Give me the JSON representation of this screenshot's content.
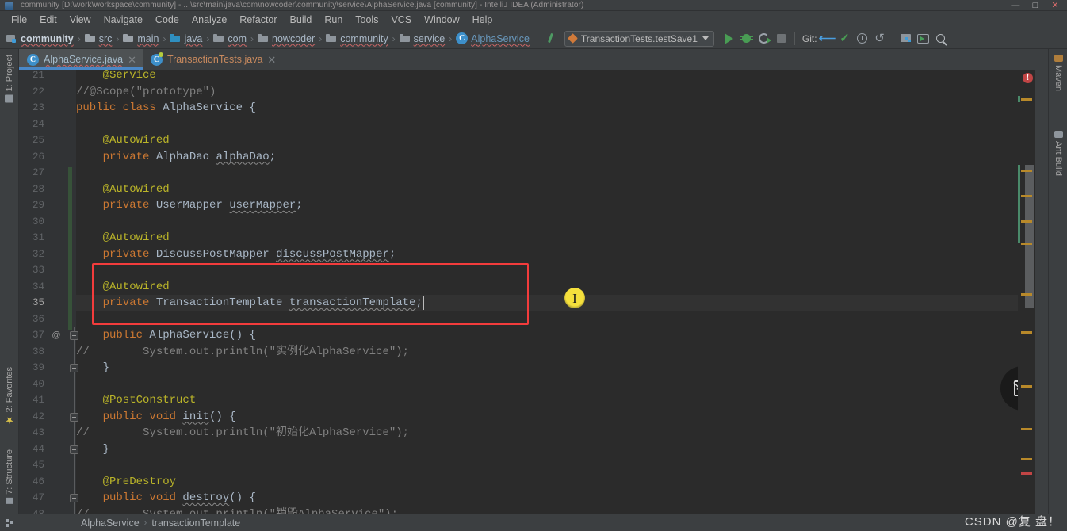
{
  "window": {
    "title": "community [D:\\work\\workspace\\community] - ...\\src\\main\\java\\com\\nowcoder\\community\\service\\AlphaService.java [community] - IntelliJ IDEA (Administrator)",
    "minimize": "—",
    "maximize": "□",
    "close": "✕"
  },
  "menubar": {
    "items": [
      "File",
      "Edit",
      "View",
      "Navigate",
      "Code",
      "Analyze",
      "Refactor",
      "Build",
      "Run",
      "Tools",
      "VCS",
      "Window",
      "Help"
    ]
  },
  "breadcrumb": {
    "items": [
      {
        "label": "community",
        "icon": "module-icon"
      },
      {
        "label": "src",
        "icon": "folder-icon"
      },
      {
        "label": "main",
        "icon": "folder-icon"
      },
      {
        "label": "java",
        "icon": "source-folder-icon"
      },
      {
        "label": "com",
        "icon": "package-icon"
      },
      {
        "label": "nowcoder",
        "icon": "package-icon"
      },
      {
        "label": "community",
        "icon": "package-icon"
      },
      {
        "label": "service",
        "icon": "package-icon"
      },
      {
        "label": "AlphaService",
        "icon": "class-icon"
      }
    ],
    "separator": "›"
  },
  "toolbar": {
    "make_project_label": "make-project",
    "run_config": "TransactionTests.testSave1",
    "run_label": "Run",
    "debug_label": "Debug",
    "coverage_label": "Run with Coverage",
    "stop_label": "Stop",
    "git_label": "Git:",
    "update_project_label": "Update Project",
    "commit_label": "Commit",
    "history_label": "History",
    "rollback_label": "Rollback",
    "structure_label": "Structure",
    "terminal_label": "Terminal",
    "search_label": "Search Everywhere"
  },
  "left_tools": [
    {
      "label": "1: Project",
      "icon": "folder-icon"
    },
    {
      "label": "2: Favorites",
      "icon": "star-icon"
    },
    {
      "label": "7: Structure",
      "icon": "structure-icon"
    }
  ],
  "right_tools": [
    {
      "label": "Maven",
      "icon": "maven-icon"
    },
    {
      "label": "Ant Build",
      "icon": "ant-icon"
    }
  ],
  "tabs": [
    {
      "label": "AlphaService.java",
      "icon": "java-class-icon",
      "active": true,
      "close": "✕"
    },
    {
      "label": "TransactionTests.java",
      "icon": "java-test-class-icon",
      "active": false,
      "close": "✕"
    }
  ],
  "editor": {
    "first_line": 21,
    "current_line": 35,
    "lines": [
      {
        "n": 21,
        "segments": [
          {
            "t": "    @Service",
            "c": "an"
          }
        ]
      },
      {
        "n": 22,
        "segments": [
          {
            "t": "//@Scope(\"prototype\")",
            "c": "cm"
          }
        ]
      },
      {
        "n": 23,
        "segments": [
          {
            "t": "public class ",
            "c": "kw"
          },
          {
            "t": "AlphaService {",
            "c": "typ"
          }
        ]
      },
      {
        "n": 24,
        "segments": [
          {
            "t": "",
            "c": "typ"
          }
        ]
      },
      {
        "n": 25,
        "segments": [
          {
            "t": "    @Autowired",
            "c": "an"
          }
        ]
      },
      {
        "n": 26,
        "segments": [
          {
            "t": "    private ",
            "c": "kw"
          },
          {
            "t": "AlphaDao ",
            "c": "typ"
          },
          {
            "t": "alphaDao",
            "c": "fldw"
          },
          {
            "t": ";",
            "c": "typ"
          }
        ]
      },
      {
        "n": 27,
        "segments": [
          {
            "t": "",
            "c": "typ"
          }
        ]
      },
      {
        "n": 28,
        "segments": [
          {
            "t": "    @Autowired",
            "c": "an"
          }
        ]
      },
      {
        "n": 29,
        "segments": [
          {
            "t": "    private ",
            "c": "kw"
          },
          {
            "t": "UserMapper ",
            "c": "typ"
          },
          {
            "t": "userMapper",
            "c": "fldw"
          },
          {
            "t": ";",
            "c": "typ"
          }
        ]
      },
      {
        "n": 30,
        "segments": [
          {
            "t": "",
            "c": "typ"
          }
        ]
      },
      {
        "n": 31,
        "segments": [
          {
            "t": "    @Autowired",
            "c": "an"
          }
        ]
      },
      {
        "n": 32,
        "segments": [
          {
            "t": "    private ",
            "c": "kw"
          },
          {
            "t": "DiscussPostMapper ",
            "c": "typ"
          },
          {
            "t": "discussPostMapper",
            "c": "fldw"
          },
          {
            "t": ";",
            "c": "typ"
          }
        ]
      },
      {
        "n": 33,
        "segments": [
          {
            "t": "",
            "c": "typ"
          }
        ]
      },
      {
        "n": 34,
        "segments": [
          {
            "t": "    @Autowired",
            "c": "an"
          }
        ]
      },
      {
        "n": 35,
        "segments": [
          {
            "t": "    private ",
            "c": "kw"
          },
          {
            "t": "TransactionTemplate ",
            "c": "typ"
          },
          {
            "t": "transactionTemplate",
            "c": "fldw"
          },
          {
            "t": ";",
            "c": "typ"
          }
        ]
      },
      {
        "n": 36,
        "segments": [
          {
            "t": "",
            "c": "typ"
          }
        ]
      },
      {
        "n": 37,
        "segments": [
          {
            "t": "    public ",
            "c": "kw"
          },
          {
            "t": "AlphaService() {",
            "c": "typ"
          }
        ]
      },
      {
        "n": 38,
        "segments": [
          {
            "t": "//        System.out.println(\"实例化AlphaService\");",
            "c": "cm"
          }
        ]
      },
      {
        "n": 39,
        "segments": [
          {
            "t": "    }",
            "c": "typ"
          }
        ]
      },
      {
        "n": 40,
        "segments": [
          {
            "t": "",
            "c": "typ"
          }
        ]
      },
      {
        "n": 41,
        "segments": [
          {
            "t": "    @PostConstruct",
            "c": "an"
          }
        ]
      },
      {
        "n": 42,
        "segments": [
          {
            "t": "    public void ",
            "c": "kw"
          },
          {
            "t": "init",
            "c": "mth"
          },
          {
            "t": "() {",
            "c": "typ"
          }
        ]
      },
      {
        "n": 43,
        "segments": [
          {
            "t": "//        System.out.println(\"初始化AlphaService\");",
            "c": "cm"
          }
        ]
      },
      {
        "n": 44,
        "segments": [
          {
            "t": "    }",
            "c": "typ"
          }
        ]
      },
      {
        "n": 45,
        "segments": [
          {
            "t": "",
            "c": "typ"
          }
        ]
      },
      {
        "n": 46,
        "segments": [
          {
            "t": "    @PreDestroy",
            "c": "an"
          }
        ]
      },
      {
        "n": 47,
        "segments": [
          {
            "t": "    public void ",
            "c": "kw"
          },
          {
            "t": "destroy",
            "c": "mth"
          },
          {
            "t": "() {",
            "c": "typ"
          }
        ]
      },
      {
        "n": 48,
        "segments": [
          {
            "t": "//        System.out.println(\"销毁AlphaService\");",
            "c": "cm"
          }
        ]
      }
    ],
    "gutter_at_marker": "@",
    "comment_prefix_lines": [
      38,
      43,
      48
    ],
    "highlight_box_lines": [
      33,
      35
    ],
    "cursor_badge_glyph": "I"
  },
  "inspections": {
    "error_count_glyph": "!",
    "error_color": "#c14545",
    "warning_color": "#b8892a",
    "changed_color": "#4a8a6a"
  },
  "statusbar": {
    "crumbs": [
      "AlphaService",
      "transactionTemplate"
    ],
    "separator": "›",
    "watermark": "CSDN @复 盘！"
  },
  "colors": {
    "editor_bg": "#2b2b2b",
    "chrome_bg": "#3c3f41",
    "gutter_bg": "#313335",
    "accent_blue": "#4a88c7",
    "annotation_red": "#f33c3c",
    "keyword_orange": "#cc7832",
    "annotation_yellow": "#bbb529",
    "comment_gray": "#808080",
    "text_default": "#a9b7c6"
  }
}
